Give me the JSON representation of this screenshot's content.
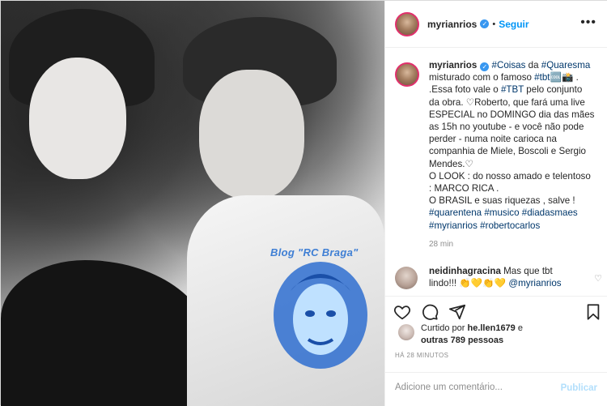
{
  "post": {
    "username": "myrianrios",
    "follow_label": "Seguir",
    "more_label": "•••",
    "image_watermark": "Blog \"RC Braga\"",
    "caption": {
      "username": "myrianrios",
      "segments": [
        {
          "text": "#Coisas",
          "tag": true
        },
        {
          "text": " da ",
          "tag": false
        },
        {
          "text": "#Quaresma",
          "tag": true
        },
        {
          "text": "\nmisturado com o famoso ",
          "tag": false
        },
        {
          "text": "#tbt",
          "tag": true
        },
        {
          "text": "🆒📸 .\n.Essa foto vale o ",
          "tag": false
        },
        {
          "text": "#TBT",
          "tag": true
        },
        {
          "text": " pelo conjunto\nda obra. ♡Roberto, que fará uma live\nESPECIAL no DOMINGO dia das mães\nas 15h no youtube - e você não pode\nperder - numa noite carioca na\ncompanhia de Miele, Boscoli e Sergio\nMendes.♡\nO LOOK : do nosso amado e telentoso\n: MARCO RICA .\nO BRASIL e suas riquezas , salve !\n",
          "tag": false
        },
        {
          "text": "#quarentena",
          "tag": true
        },
        {
          "text": " ",
          "tag": false
        },
        {
          "text": "#musico",
          "tag": true
        },
        {
          "text": " ",
          "tag": false
        },
        {
          "text": "#diadasmaes",
          "tag": true
        },
        {
          "text": "\n",
          "tag": false
        },
        {
          "text": "#myrianrios",
          "tag": true
        },
        {
          "text": " ",
          "tag": false
        },
        {
          "text": "#robertocarlos",
          "tag": true
        }
      ],
      "time": "28 min"
    },
    "comment": {
      "username": "neidinhagracina",
      "text": " Mas que tbt\nlindo!!! 👏💛👏💛 ",
      "mention": "@myrianrios"
    },
    "likes": {
      "prefix": "Curtido por ",
      "user": "he.llen1679",
      "middle": " e",
      "others": "outras 789 pessoas"
    },
    "posted_ago": "HÁ 28 MINUTOS",
    "add_comment": {
      "placeholder": "Adicione um comentário...",
      "publish_label": "Publicar"
    },
    "colors": {
      "accent": "#0095f6",
      "hashtag": "#00376b",
      "verified": "#3897f0",
      "watermark": "#3f7fd4"
    },
    "icons": [
      "heart-icon",
      "comment-icon",
      "share-icon",
      "bookmark-icon",
      "verified-icon",
      "more-icon"
    ]
  }
}
